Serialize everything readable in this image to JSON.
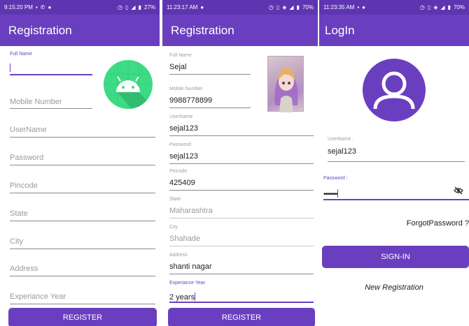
{
  "screen1": {
    "status": {
      "time": "9:15:20 PM",
      "battery": "27%"
    },
    "title": "Registration",
    "full_name_label": "Full Name",
    "placeholders": {
      "mobile": "Mobile Number",
      "username": "UserName",
      "password": "Password",
      "pincode": "Pincode",
      "state": "State",
      "city": "City",
      "address": "Address",
      "experience": "Experiance Year"
    },
    "register_label": "REGISTER"
  },
  "screen2": {
    "status": {
      "time": "11:23:17 AM",
      "battery": "70%"
    },
    "title": "Registration",
    "labels": {
      "full_name": "Full Name",
      "mobile": "Mobile Number",
      "username": "UserName",
      "password": "Password",
      "pincode": "Pincode",
      "state": "State",
      "city": "City",
      "address": "Address",
      "experience": "Experiance Year"
    },
    "values": {
      "full_name": "Sejal",
      "mobile": "9988778899",
      "username": "sejal123",
      "password": "sejal123",
      "pincode": "425409",
      "state": "Maharashtra",
      "city": "Shahade",
      "address": "shanti nagar",
      "experience": "2 years"
    },
    "register_label": "REGISTER"
  },
  "screen3": {
    "status": {
      "time": "11:23:35 AM",
      "battery": "70%"
    },
    "title": "LogIn",
    "username_label": "UserName :",
    "username_value": "sejal123",
    "password_label": "Password :",
    "password_value": "••••••••",
    "forgot_label": "ForgotPassword ?",
    "signin_label": "SIGN-IN",
    "new_registration_label": "New Registration"
  },
  "colors": {
    "primary": "#6a3fbf",
    "status_bar": "#5e35b1",
    "android_green": "#3ddc84"
  },
  "icons": [
    "android-logo-icon",
    "user-avatar-icon",
    "eye-off-icon",
    "wifi-icon",
    "battery-icon"
  ]
}
